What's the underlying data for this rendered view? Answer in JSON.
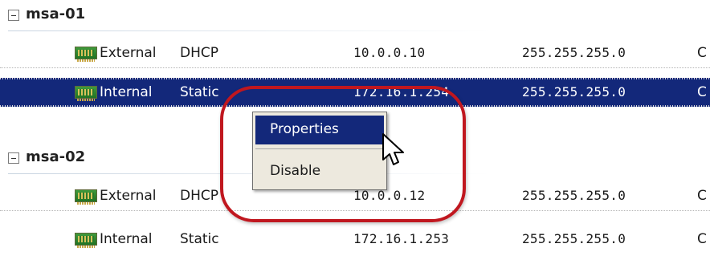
{
  "groups": [
    {
      "title": "msa-01",
      "adapters": [
        {
          "name": "External",
          "mode": "DHCP",
          "ip": "10.0.0.10",
          "mask": "255.255.255.0",
          "extra": "C"
        },
        {
          "name": "Internal",
          "mode": "Static",
          "ip": "172.16.1.254",
          "mask": "255.255.255.0",
          "extra": "C"
        }
      ]
    },
    {
      "title": "msa-02",
      "adapters": [
        {
          "name": "External",
          "mode": "DHCP",
          "ip": "10.0.0.12",
          "mask": "255.255.255.0",
          "extra": "C"
        },
        {
          "name": "Internal",
          "mode": "Static",
          "ip": "172.16.1.253",
          "mask": "255.255.255.0",
          "extra": "C"
        }
      ]
    }
  ],
  "context_menu": {
    "items": [
      "Properties",
      "Disable"
    ],
    "active_item": "Properties"
  },
  "icons": {
    "group_toggle": "collapse-minus-icon",
    "adapter": "network-adapter-icon",
    "pointer": "mouse-pointer-icon"
  },
  "colors": {
    "selection": "#13287a",
    "highlight_ring": "#c0171f",
    "menu_background": "#ede9de"
  }
}
